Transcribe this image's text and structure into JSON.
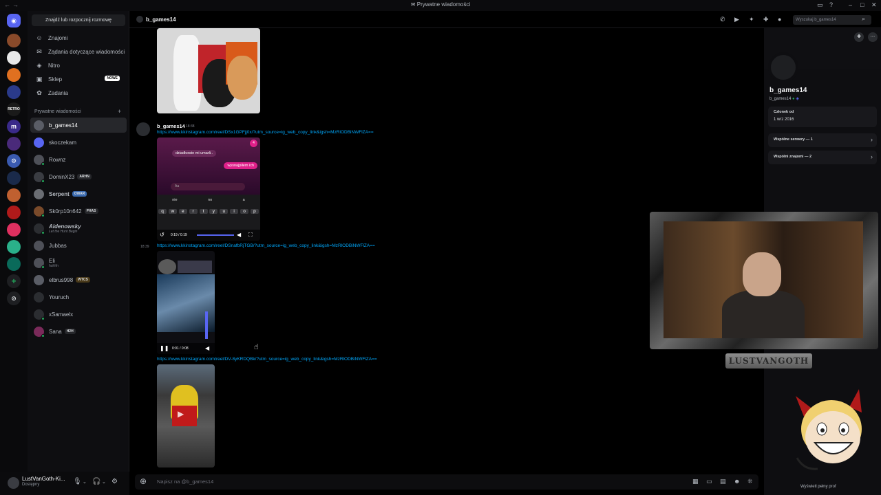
{
  "window": {
    "title": "Prywatne wiadomości"
  },
  "sidebar": {
    "search_button": "Znajdź lub rozpocznij rozmowę",
    "nav": [
      {
        "label": "Znajomi",
        "icon": "friends-icon"
      },
      {
        "label": "Żądania dotyczące wiadomości",
        "icon": "envelope-icon"
      },
      {
        "label": "Nitro",
        "icon": "nitro-icon"
      },
      {
        "label": "Sklep",
        "icon": "shop-icon",
        "badge": "NOWE"
      },
      {
        "label": "Zadania",
        "icon": "quests-icon"
      }
    ],
    "dm_header": "Prywatne wiadomości",
    "dms": [
      {
        "name": "b_games14",
        "active": true,
        "color": "#5a5d66"
      },
      {
        "name": "skoczekam",
        "color": "#5865f2"
      },
      {
        "name": "Rownz",
        "color": "#4e5058"
      },
      {
        "name": "DominX23",
        "tag": "ARHN",
        "color": "#3a3c42"
      },
      {
        "name": "Serpent",
        "tag": "OWAR",
        "color": "#6a6d73"
      },
      {
        "name": "Sk0rp10n642",
        "tag": "PHAS",
        "color": "#7a4a2a"
      },
      {
        "name": "Aidenowsky",
        "sub": "Let the Hunt Begin",
        "color": "#2b2d31"
      },
      {
        "name": "Jubbas",
        "color": "#4e5058"
      },
      {
        "name": "Eli",
        "sub": "huhhh",
        "color": "#4e5058"
      },
      {
        "name": "elbrus998",
        "tag": "WTCS",
        "color": "#5a5d66"
      },
      {
        "name": "Youruch",
        "color": "#2b2d31"
      },
      {
        "name": "xSamaelx",
        "color": "#2b2d31"
      },
      {
        "name": "Sana",
        "tag": "H2H",
        "color": "#7a2a5a"
      }
    ]
  },
  "user_panel": {
    "name": "LustVanGoth-Ki...",
    "status": "Dostępny"
  },
  "chat_header": {
    "name": "b_games14",
    "search_placeholder": "Wyszukaj b_games14"
  },
  "messages": [
    {
      "author": "b_games14",
      "time": "18:38",
      "link": "https://www.kkinstagram.com/reel/DSx1GPFjj0x/?utm_source=ig_web_copy_link&igsh=MzRlODBiNWFlZA==",
      "video": {
        "bubble1": "dziadkowie mi umarli..",
        "bubble2": "wysnajpiłem ich",
        "input_ph": "Aa",
        "suggestions": [
          "nie",
          "no",
          "a"
        ],
        "keys": [
          "q",
          "w",
          "e",
          "r",
          "t",
          "y",
          "u",
          "i",
          "o",
          "p"
        ],
        "time": "0:19 / 0:19",
        "counter": "4"
      }
    },
    {
      "time": "18:39",
      "link": "https://www.kkinstagram.com/reel/DSnafbRjTGB/?utm_source=ig_web_copy_link&igsh=MzRlODBiNWFlZA==",
      "video": {
        "time": "0:01 / 0:08"
      }
    },
    {
      "link": "https://www.kkinstagram.com/reel/DV-8yKRDQBk/?utm_source=ig_web_copy_link&igsh=MzRlODBiNWFlZA=="
    }
  ],
  "composer": {
    "placeholder": "Napisz na @b_games14"
  },
  "profile": {
    "name": "b_games14",
    "username": "b_games14",
    "member_label": "Członek od",
    "member_since": "1 wrz 2016",
    "mutual_servers": "Wspólne serwery — 1",
    "mutual_friends": "Wspólni znajomi — 2",
    "full_profile": "Wyświetl pełny prof"
  },
  "overlay": {
    "cam_label": "LUSTVANGOTH"
  }
}
